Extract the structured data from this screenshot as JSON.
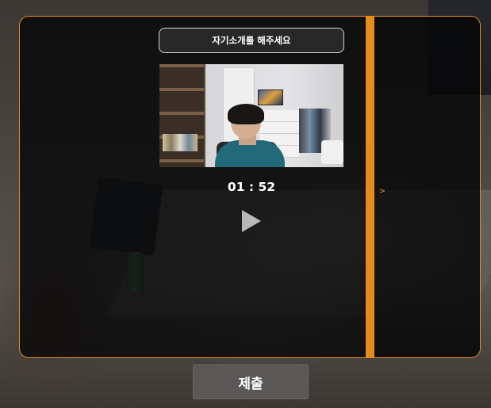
{
  "prompt": {
    "text": "자기소개를 해주세요"
  },
  "recording": {
    "timer": "01 : 52"
  },
  "controls": {
    "play_icon": "play-icon",
    "side_toggle_label": ">"
  },
  "footer": {
    "submit_label": "제출"
  },
  "colors": {
    "accent": "#e58c1e",
    "panel_bg": "#060608",
    "submit_bg": "#5a5856"
  }
}
